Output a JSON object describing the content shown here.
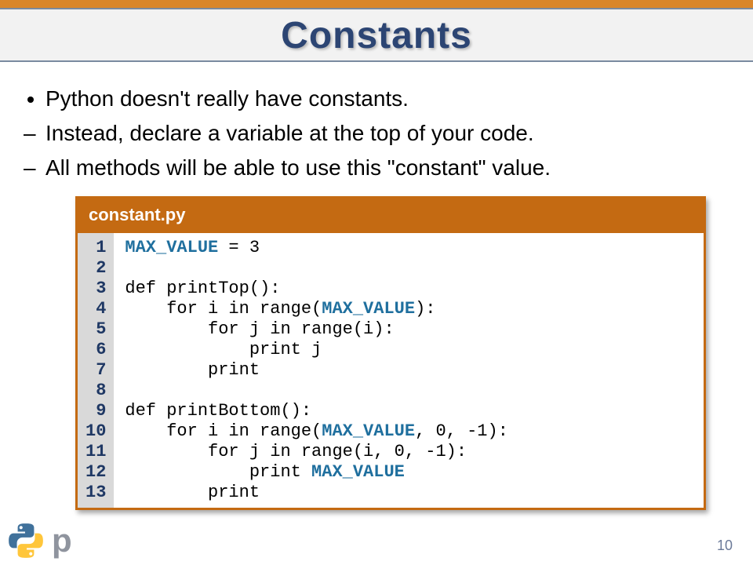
{
  "title": "Constants",
  "bullets": {
    "main": "Python doesn't really have constants.",
    "sub1": "Instead, declare a variable at the top of your code.",
    "sub2": "All methods will be able to use this \"constant\" value."
  },
  "filename": "constant.py",
  "code": {
    "line_numbers": " 1\n 2\n 3\n 4\n 5\n 6\n 7\n 8\n 9\n10\n11\n12\n13",
    "l1_const": "MAX_VALUE",
    "l1_rest": " = 3",
    "l3": "def printTop():",
    "l4a": "    for i in range(",
    "l4_const": "MAX_VALUE",
    "l4b": "):",
    "l5": "        for j in range(i):",
    "l6": "            print j",
    "l7": "        print",
    "l9": "def printBottom():",
    "l10a": "    for i in range(",
    "l10_const": "MAX_VALUE",
    "l10b": ", 0, -1):",
    "l11": "        for j in range(i, 0, -1):",
    "l12a": "            print ",
    "l12_const": "MAX_VALUE",
    "l13": "        print"
  },
  "page_number": "10",
  "logo_text": "p"
}
